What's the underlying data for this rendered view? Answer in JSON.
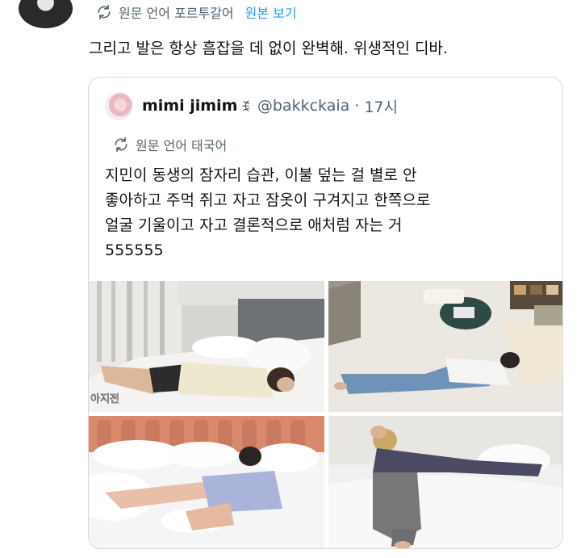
{
  "header": {
    "translation_label": "원문 언어 포르투갈어",
    "view_original_link": "원본 보기"
  },
  "tweet": {
    "text": "그리고 발은 항상 흠잡을 데 없이 완벽해. 위생적인 디바."
  },
  "quote": {
    "display_name": "mimi jimim",
    "name_emoji": "ꉂ",
    "handle": "@bakkckaia",
    "separator": "·",
    "time": "17시",
    "translation_label": "원문 언어 태국어",
    "text_lines": [
      "지민이 동생의 잠자리 습관, 이불 덮는 걸 별로 안",
      "좋아하고 주먹 쥐고 자고 잠옷이 구겨지고 한쪽으로",
      "얼굴 기울이고 자고 결론적으로 애처럼 자는 거",
      "555555"
    ],
    "photo_captions": {
      "first": "아지전"
    }
  },
  "colors": {
    "link": "#1d9bf0",
    "secondary_text": "#536471",
    "border": "#cfd9de"
  },
  "icons": {
    "translate": "translate-icon"
  }
}
